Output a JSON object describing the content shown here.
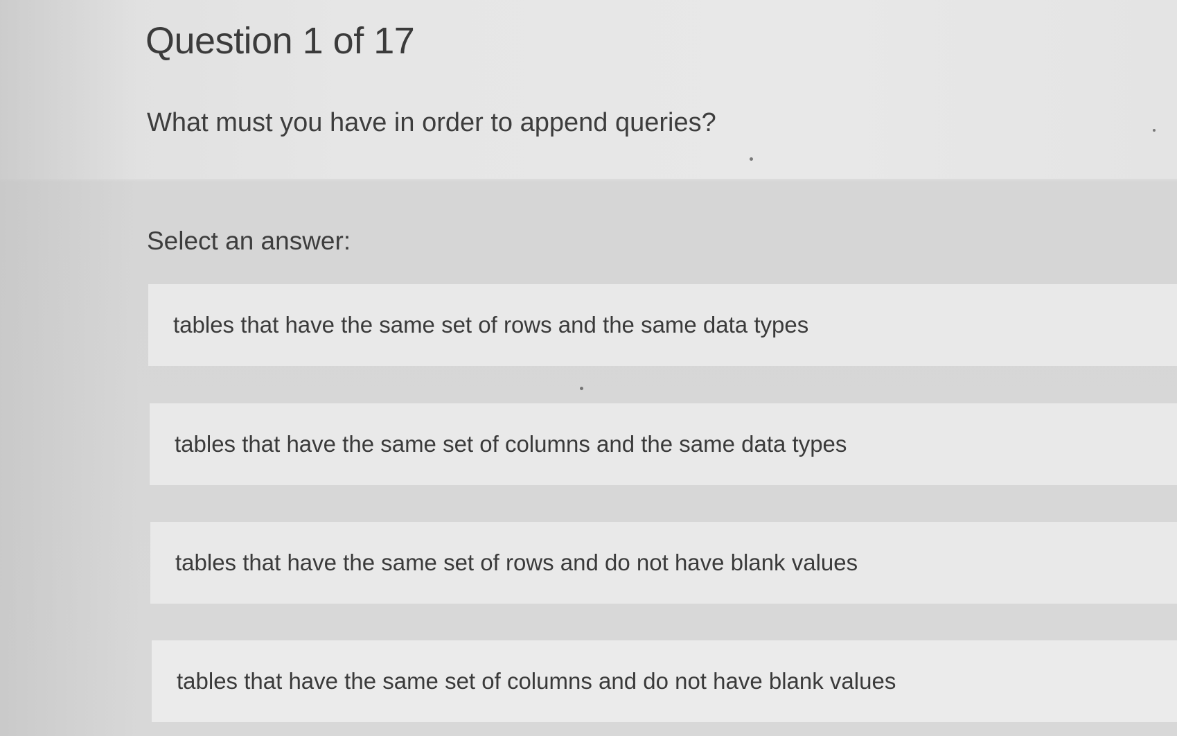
{
  "quiz": {
    "header": "Question 1 of 17",
    "question": "What must you have in order to append queries?",
    "select_label": "Select an answer:",
    "answers": [
      {
        "label": "tables that have the same set of rows and the same data types"
      },
      {
        "label": "tables that have the same set of columns and the same data types"
      },
      {
        "label": "tables that have the same set of rows and do not have blank values"
      },
      {
        "label": "tables that have the same set of columns and do not have blank values"
      }
    ]
  },
  "colors": {
    "background": "#d8d8d8",
    "answer_background": "#e9e9e9",
    "text": "#3a3a3a"
  }
}
